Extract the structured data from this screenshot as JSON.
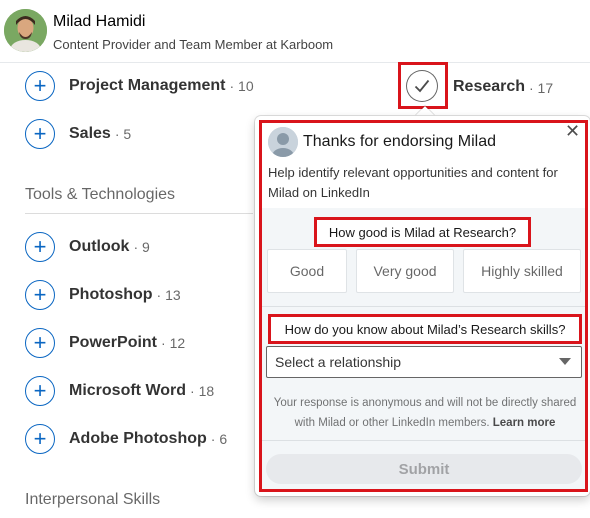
{
  "profile": {
    "name": "Milad Hamidi",
    "headline": "Content Provider and Team Member at Karboom"
  },
  "skills_top": [
    {
      "name": "Project Management",
      "count": "· 10"
    },
    {
      "name": "Sales",
      "count": "· 5"
    }
  ],
  "research": {
    "name": "Research",
    "count": "· 17",
    "endorsed": true
  },
  "tools_section": {
    "title": "Tools & Technologies",
    "skills": [
      {
        "name": "Outlook",
        "count": "· 9"
      },
      {
        "name": "Photoshop",
        "count": "· 13"
      },
      {
        "name": "PowerPoint",
        "count": "· 12"
      },
      {
        "name": "Microsoft Word",
        "count": "· 18"
      },
      {
        "name": "Adobe Photoshop",
        "count": "· 6"
      }
    ]
  },
  "interpersonal_section": {
    "title": "Interpersonal Skills"
  },
  "popover": {
    "title": "Thanks for endorsing Milad",
    "description": "Help identify relevant opportunities and content for Milad on LinkedIn",
    "question1": "How good is Milad at Research?",
    "ratings": [
      "Good",
      "Very good",
      "Highly skilled"
    ],
    "question2": "How do you know about Milad’s Research skills?",
    "select_placeholder": "Select a relationship",
    "notice": "Your response is anonymous and will not be directly shared with Milad or other LinkedIn members.",
    "learn_more": "Learn more",
    "submit": "Submit",
    "close": "✕"
  },
  "icons": {
    "plus": "plus-icon",
    "check": "checkmark-icon",
    "close": "close-icon",
    "caret": "chevron-down-icon"
  },
  "colors": {
    "accent": "#0a66c2",
    "highlight": "#d9141b",
    "submit_disabled_bg": "#e7e9ec"
  }
}
